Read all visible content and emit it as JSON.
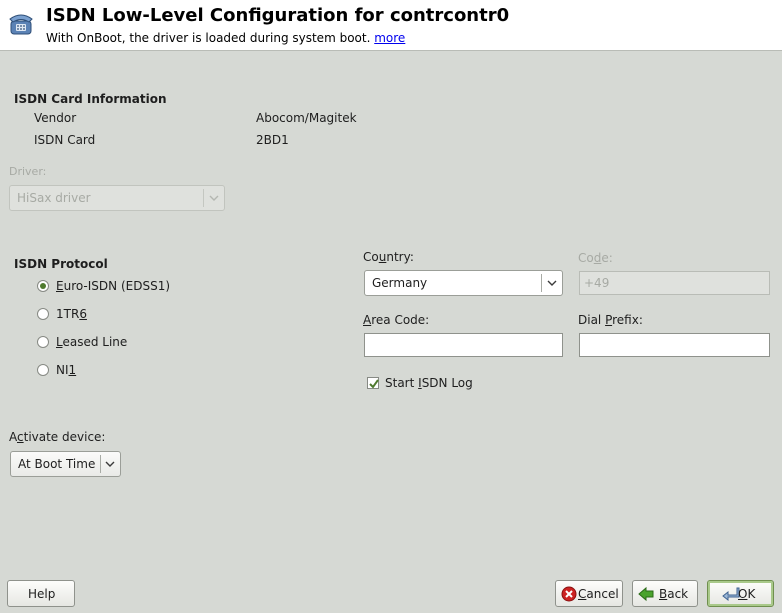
{
  "header": {
    "title": "ISDN Low-Level Configuration for contrcontr0",
    "subtitle": "With OnBoot, the driver is loaded during system boot.",
    "more_link": "more",
    "icon": "telephone-icon"
  },
  "card_info": {
    "title": "ISDN Card Information",
    "vendor_label": "Vendor",
    "vendor_value": "Abocom/Magitek",
    "card_label": "ISDN Card",
    "card_value": "2BD1"
  },
  "driver": {
    "label": "Driver:",
    "value": "HiSax driver"
  },
  "protocol": {
    "title": "ISDN Protocol",
    "options": [
      {
        "pre": "",
        "mn": "E",
        "post": "uro-ISDN (EDSS1)",
        "checked": true
      },
      {
        "pre": "1TR",
        "mn": "6",
        "post": "",
        "checked": false
      },
      {
        "pre": "",
        "mn": "L",
        "post": "eased Line",
        "checked": false
      },
      {
        "pre": "NI",
        "mn": "1",
        "post": "",
        "checked": false
      }
    ]
  },
  "country": {
    "label_pre": "Co",
    "label_mn": "u",
    "label_post": "ntry:",
    "value": "Germany"
  },
  "code": {
    "label_pre": "Co",
    "label_mn": "d",
    "label_post": "e:",
    "value": "+49"
  },
  "area_code": {
    "label_pre": "",
    "label_mn": "A",
    "label_post": "rea Code:",
    "value": ""
  },
  "dial_prefix": {
    "label_pre": "Dial ",
    "label_mn": "P",
    "label_post": "refix:",
    "value": ""
  },
  "isdn_log": {
    "label_pre": "Start ",
    "label_mn": "I",
    "label_post": "SDN Log",
    "checked": true
  },
  "activate": {
    "label_pre": "A",
    "label_mn": "c",
    "label_post": "tivate device:",
    "value": "At Boot Time"
  },
  "buttons": {
    "help": "Help",
    "cancel_mn": "C",
    "cancel_rest": "ancel",
    "back_mn": "B",
    "back_rest": "ack",
    "ok_mn": "O",
    "ok_rest": "K"
  },
  "colors": {
    "accent": "#4f7a2e",
    "background": "#d6d9d4",
    "link": "#0000ee"
  }
}
